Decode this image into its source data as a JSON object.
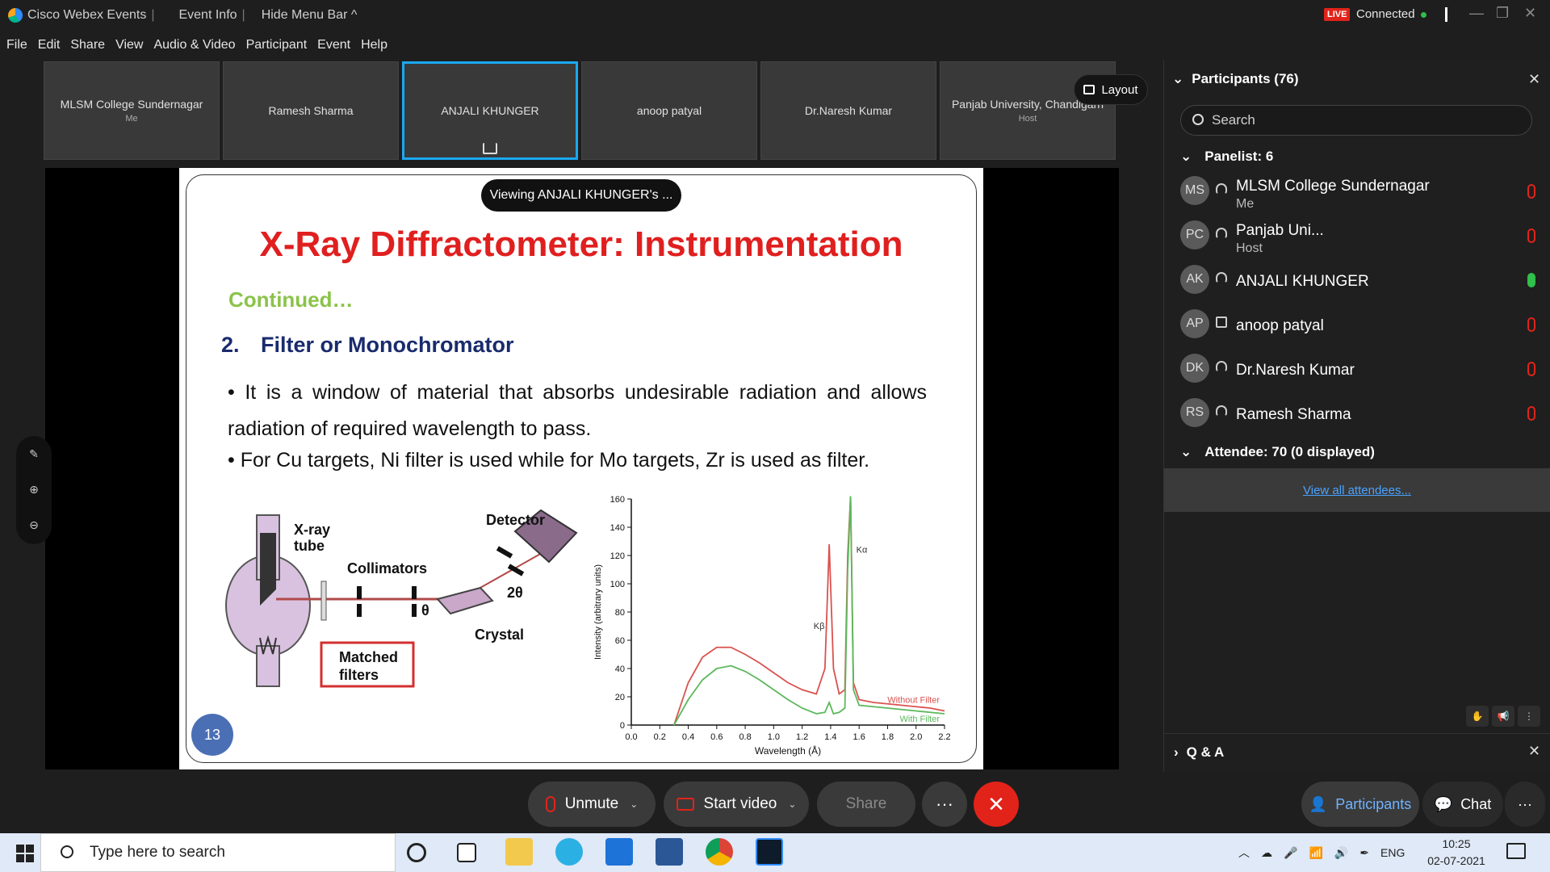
{
  "titlebar": {
    "app": "Cisco Webex Events",
    "event_info": "Event Info",
    "hide_menu": "Hide Menu Bar ^",
    "live": "LIVE",
    "connected": "Connected"
  },
  "menu": [
    "File",
    "Edit",
    "Share",
    "View",
    "Audio & Video",
    "Participant",
    "Event",
    "Help"
  ],
  "thumbs": [
    {
      "name": "MLSM College Sundernagar",
      "sub": "Me"
    },
    {
      "name": "Ramesh Sharma",
      "sub": ""
    },
    {
      "name": "ANJALI KHUNGER",
      "sub": ""
    },
    {
      "name": "anoop patyal",
      "sub": ""
    },
    {
      "name": "Dr.Naresh Kumar",
      "sub": ""
    },
    {
      "name": "Panjab University, Chandigarh",
      "sub": "Host"
    }
  ],
  "layout_label": "Layout",
  "viewing": "Viewing ANJALI KHUNGER's ...",
  "slide": {
    "title": "X-Ray Diffractometer: Instrumentation",
    "continued": "Continued…",
    "num": "2.",
    "heading": "Filter or Monochromator",
    "bullet1": "• It is a window of material that absorbs undesirable radiation and allows radiation of required wavelength to pass.",
    "bullet2": "• For Cu targets, Ni filter is used while for Mo targets, Zr is used as filter.",
    "page": "13",
    "diagram": {
      "tube": "X-ray tube",
      "collimators": "Collimators",
      "detector": "Detector",
      "crystal": "Crystal",
      "filters": "Matched filters",
      "theta": "θ",
      "two_theta": "2θ"
    }
  },
  "chart_data": {
    "type": "line",
    "xlabel": "Wavelength (Å)",
    "ylabel": "Intensity (arbitrary units)",
    "xlim": [
      0,
      2.2
    ],
    "ylim": [
      0,
      160
    ],
    "xticks": [
      "0.0",
      "0.2",
      "0.4",
      "0.6",
      "0.8",
      "1.0",
      "1.2",
      "1.4",
      "1.6",
      "1.8",
      "2.0",
      "2.2"
    ],
    "yticks": [
      "0",
      "20",
      "40",
      "60",
      "80",
      "100",
      "120",
      "140",
      "160"
    ],
    "annotations": [
      "Kα",
      "Kβ"
    ],
    "series": [
      {
        "name": "Without Filter",
        "color": "#d9534f",
        "x": [
          0.3,
          0.4,
          0.5,
          0.6,
          0.7,
          0.8,
          0.9,
          1.0,
          1.1,
          1.2,
          1.3,
          1.36,
          1.39,
          1.42,
          1.46,
          1.5,
          1.52,
          1.54,
          1.56,
          1.6,
          1.7,
          1.8,
          1.9,
          2.0,
          2.1,
          2.2
        ],
        "y": [
          0,
          30,
          48,
          55,
          55,
          50,
          44,
          37,
          30,
          25,
          22,
          40,
          128,
          40,
          22,
          25,
          120,
          165,
          30,
          18,
          16,
          15,
          14,
          13,
          12,
          10
        ]
      },
      {
        "name": "With Filter",
        "color": "#5cb85c",
        "x": [
          0.3,
          0.4,
          0.5,
          0.6,
          0.7,
          0.8,
          0.9,
          1.0,
          1.1,
          1.2,
          1.3,
          1.36,
          1.39,
          1.42,
          1.46,
          1.5,
          1.52,
          1.54,
          1.56,
          1.6,
          1.7,
          1.8,
          1.9,
          2.0,
          2.1,
          2.2
        ],
        "y": [
          0,
          18,
          32,
          40,
          42,
          38,
          32,
          25,
          18,
          12,
          8,
          9,
          16,
          8,
          9,
          12,
          110,
          170,
          25,
          14,
          13,
          12,
          11,
          10,
          9,
          8
        ]
      }
    ]
  },
  "tools": [
    "annotate",
    "zoom-in",
    "zoom-out"
  ],
  "controls": {
    "unmute": "Unmute",
    "start_video": "Start video",
    "share": "Share",
    "more": "···",
    "end": "✕"
  },
  "panel": {
    "title": "Participants (76)",
    "search_placeholder": "Search",
    "panelist_header": "Panelist: 6",
    "attendee_header": "Attendee: 70 (0 displayed)",
    "view_all": "View all attendees...",
    "qa": "Q & A",
    "participants": [
      {
        "initials": "MS",
        "name": "MLSM College Sundernagar",
        "role": "Me",
        "mic": "muted"
      },
      {
        "initials": "PC",
        "name": "Panjab Uni...",
        "role": "Host",
        "mic": "muted"
      },
      {
        "initials": "AK",
        "name": "ANJALI KHUNGER",
        "role": "",
        "mic": "on"
      },
      {
        "initials": "AP",
        "name": "anoop patyal",
        "role": "",
        "mic": "muted"
      },
      {
        "initials": "DK",
        "name": "Dr.Naresh Kumar",
        "role": "",
        "mic": "muted"
      },
      {
        "initials": "RS",
        "name": "Ramesh Sharma",
        "role": "",
        "mic": "muted"
      }
    ]
  },
  "bottom_right": {
    "participants": "Participants",
    "chat": "Chat",
    "more": "···"
  },
  "taskbar": {
    "search": "Type here to search",
    "lang": "ENG",
    "time": "10:25",
    "date": "02-07-2021"
  }
}
